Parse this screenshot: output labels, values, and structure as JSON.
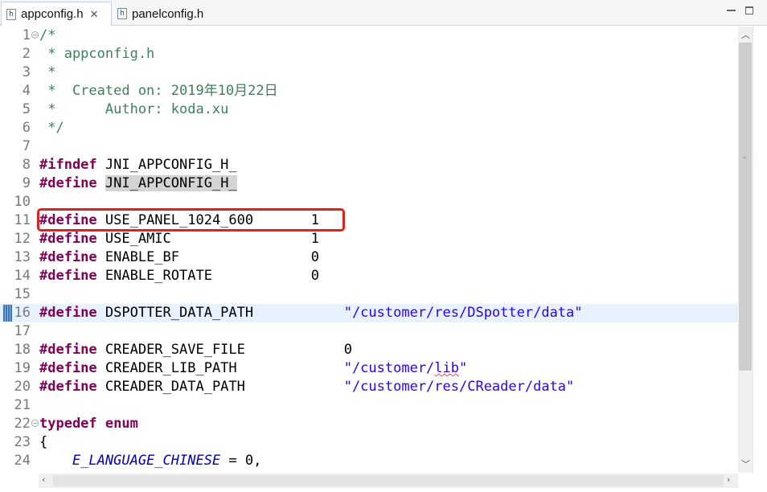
{
  "tabs": [
    {
      "label": "appconfig.h",
      "active": true,
      "icon": "h-file-icon",
      "close": "✕"
    },
    {
      "label": "panelconfig.h",
      "active": false,
      "icon": "h-file-icon"
    }
  ],
  "editor": {
    "current_line": 16,
    "lines": [
      {
        "n": "1",
        "fold": "⊖",
        "tokens": [
          {
            "t": "/*",
            "c": "cmt"
          }
        ]
      },
      {
        "n": "2",
        "tokens": [
          {
            "t": " * appconfig.h",
            "c": "cmt"
          }
        ]
      },
      {
        "n": "3",
        "tokens": [
          {
            "t": " *",
            "c": "cmt"
          }
        ]
      },
      {
        "n": "4",
        "tokens": [
          {
            "t": " *  Created on: 2019年10月22日",
            "c": "cmt"
          }
        ]
      },
      {
        "n": "5",
        "tokens": [
          {
            "t": " *      Author: koda.xu",
            "c": "cmt"
          }
        ]
      },
      {
        "n": "6",
        "tokens": [
          {
            "t": " */",
            "c": "cmt"
          }
        ]
      },
      {
        "n": "7",
        "tokens": []
      },
      {
        "n": "8",
        "tokens": [
          {
            "t": "#ifndef",
            "c": "kw"
          },
          {
            "t": " JNI_APPCONFIG_H_",
            "c": ""
          }
        ]
      },
      {
        "n": "9",
        "tokens": [
          {
            "t": "#define",
            "c": "kw"
          },
          {
            "t": " ",
            "c": ""
          },
          {
            "t": "JNI_APPCONFIG_H_",
            "c": "hl"
          }
        ]
      },
      {
        "n": "10",
        "tokens": []
      },
      {
        "n": "11",
        "tokens": [
          {
            "t": "#define",
            "c": "kw"
          },
          {
            "t": " USE_PANEL_1024_600       1",
            "c": ""
          }
        ]
      },
      {
        "n": "12",
        "tokens": [
          {
            "t": "#define",
            "c": "kw"
          },
          {
            "t": " USE_AMIC                 1",
            "c": ""
          }
        ]
      },
      {
        "n": "13",
        "tokens": [
          {
            "t": "#define",
            "c": "kw"
          },
          {
            "t": " ENABLE_BF                0",
            "c": ""
          }
        ]
      },
      {
        "n": "14",
        "tokens": [
          {
            "t": "#define",
            "c": "kw"
          },
          {
            "t": " ENABLE_ROTATE            0",
            "c": ""
          }
        ]
      },
      {
        "n": "15",
        "tokens": []
      },
      {
        "n": "16",
        "tokens": [
          {
            "t": "#define",
            "c": "kw"
          },
          {
            "t": " DSPOTTER_DATA_PATH           ",
            "c": ""
          },
          {
            "t": "\"/customer/res/DSpotter/data\"",
            "c": "str"
          }
        ]
      },
      {
        "n": "17",
        "tokens": []
      },
      {
        "n": "18",
        "tokens": [
          {
            "t": "#define",
            "c": "kw"
          },
          {
            "t": " CREADER_SAVE_FILE            0",
            "c": ""
          }
        ]
      },
      {
        "n": "19",
        "tokens": [
          {
            "t": "#define",
            "c": "kw"
          },
          {
            "t": " CREADER_LIB_PATH             ",
            "c": ""
          },
          {
            "t": "\"/customer/",
            "c": "str"
          },
          {
            "t": "lib",
            "c": "str spell"
          },
          {
            "t": "\"",
            "c": "str"
          }
        ]
      },
      {
        "n": "20",
        "tokens": [
          {
            "t": "#define",
            "c": "kw"
          },
          {
            "t": " CREADER_DATA_PATH            ",
            "c": ""
          },
          {
            "t": "\"/customer/res/CReader/data\"",
            "c": "str"
          }
        ]
      },
      {
        "n": "21",
        "tokens": []
      },
      {
        "n": "22",
        "fold": "⊖",
        "tokens": [
          {
            "t": "typedef",
            "c": "kw"
          },
          {
            "t": " ",
            "c": ""
          },
          {
            "t": "enum",
            "c": "kw"
          }
        ]
      },
      {
        "n": "23",
        "tokens": [
          {
            "t": "{",
            "c": ""
          }
        ]
      },
      {
        "n": "24",
        "tokens": [
          {
            "t": "    ",
            "c": ""
          },
          {
            "t": "E_LANGUAGE_CHINESE",
            "c": "enumc"
          },
          {
            "t": " = 0,",
            "c": ""
          }
        ]
      }
    ]
  },
  "colors": {
    "comment": "#3f7f5f",
    "keyword": "#7f0055",
    "string": "#2a00ff",
    "enum_constant": "#0000c0",
    "annotation": "#e0201a",
    "current_line": "#e8f2fe"
  }
}
